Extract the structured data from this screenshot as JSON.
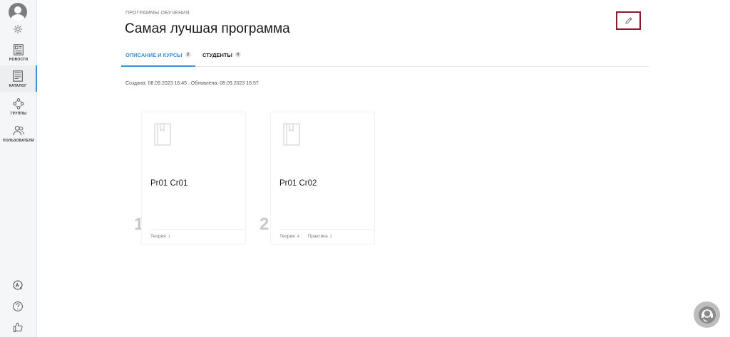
{
  "sidebar": {
    "items": [
      {
        "label": "НОВОСТИ",
        "icon": "news-icon"
      },
      {
        "label": "КАТАЛОГ",
        "icon": "catalog-icon",
        "active": true
      },
      {
        "label": "ГРУППЫ",
        "icon": "groups-icon"
      },
      {
        "label": "ПОЛЬЗОВАТЕЛИ",
        "icon": "users-icon"
      }
    ],
    "bottom_icons": [
      "translate-icon",
      "help-icon",
      "like-icon"
    ]
  },
  "header": {
    "breadcrumb": "ПРОГРАММЫ ОБУЧЕНИЯ",
    "title": "Самая лучшая программа"
  },
  "tabs": [
    {
      "label": "ОПИСАНИЕ И КУРСЫ",
      "count": "2",
      "active": true
    },
    {
      "label": "СТУДЕНТЫ",
      "count": "0",
      "active": false
    }
  ],
  "meta": "Создана: 08.09.2023 16:45 , Обновлена: 08.09.2023 16:57",
  "courses": [
    {
      "number": "1",
      "title": "Pr01 Cr01",
      "stats": [
        {
          "label": "Теория",
          "count": "1"
        }
      ]
    },
    {
      "number": "2",
      "title": "Pr01 Cr02",
      "stats": [
        {
          "label": "Теория",
          "count": "4"
        },
        {
          "label": "Практика",
          "count": "2"
        }
      ]
    }
  ],
  "colors": {
    "accent": "#3b8fd6",
    "edit_border": "#8b1a2d",
    "sidebar_bg": "#f5f6f7"
  }
}
